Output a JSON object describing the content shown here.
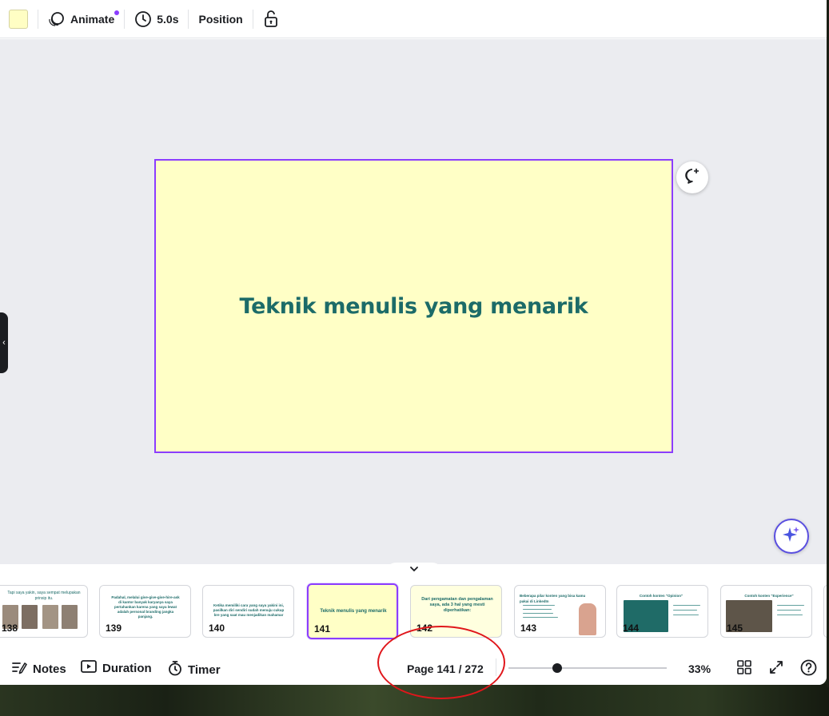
{
  "toolbar": {
    "swatch_color": "#fffec4",
    "animate_label": "Animate",
    "duration_label": "5.0s",
    "position_label": "Position"
  },
  "slide": {
    "title": "Teknik menulis yang menarik",
    "background": "#ffffc6",
    "title_color": "#1c6b68"
  },
  "pages": [
    {
      "num": "138",
      "text": "Tapi saya yakin, saya sempat melupakan prinsip itu."
    },
    {
      "num": "139",
      "text": "Padahal, melalui give-give-give-hire-ask di kantor banyak karyanya saya pertahankan karena yang saya lewat adalah personal branding jangka panjang."
    },
    {
      "num": "140",
      "text": "Ketika memiliki cara yang saya yakini ini, pasilkan diri sendiri sudah menuju cukup bre yang saat mau menjadikan mahamar"
    },
    {
      "num": "141",
      "text": "Teknik menulis yang menarik"
    },
    {
      "num": "142",
      "text": "Dari pengamatan dan pengalaman saya, ada 3 hal yang mesti diperhatikan:"
    },
    {
      "num": "143",
      "text": "Beberapa pilar konten yang bisa kamu pakai di LinkedIn"
    },
    {
      "num": "144",
      "text": "Contoh konten \"Opinion\""
    },
    {
      "num": "145",
      "text": "Contoh konten \"Experience\""
    }
  ],
  "footer": {
    "notes_label": "Notes",
    "duration_label": "Duration",
    "timer_label": "Timer",
    "page_indicator": "Page 141 / 272",
    "zoom": "33%"
  },
  "accent_color": "#8b3dff",
  "annotation_color": "#e0161b"
}
